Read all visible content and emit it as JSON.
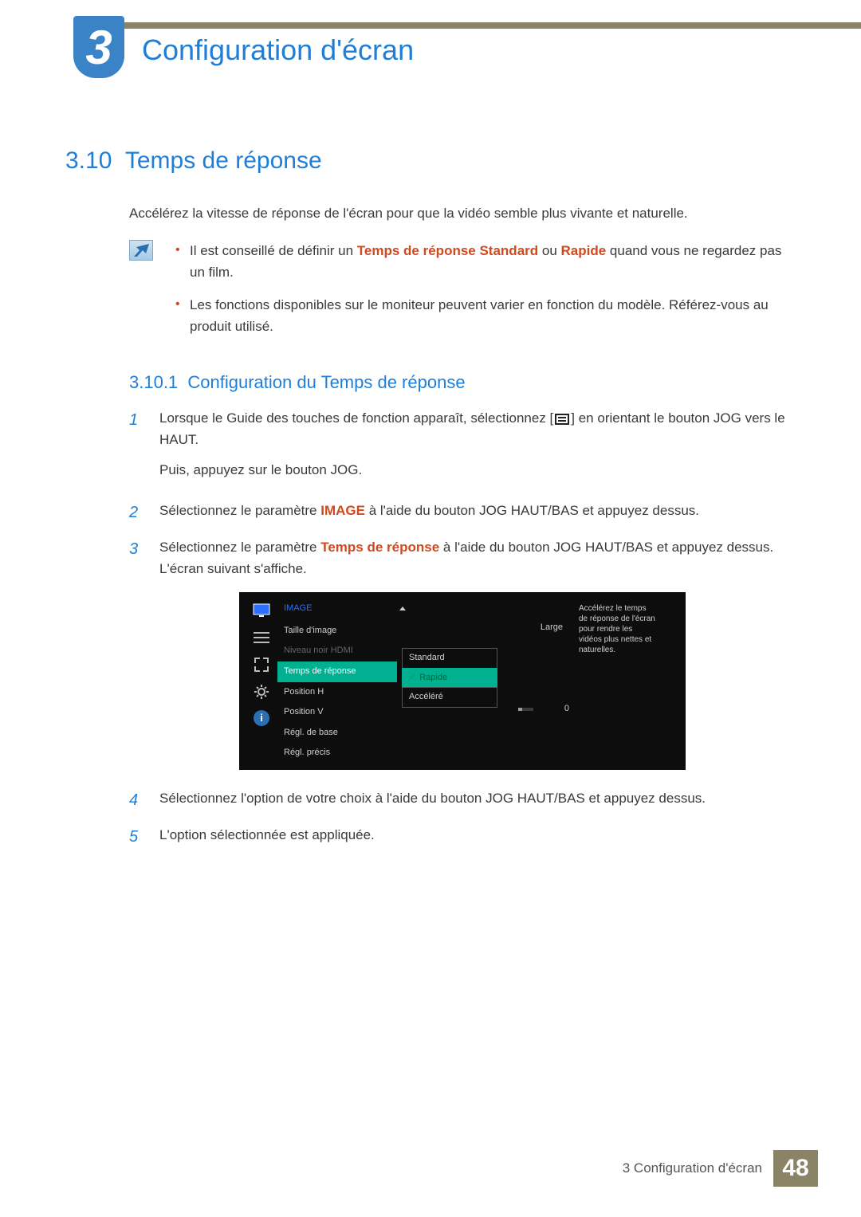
{
  "chapter": {
    "number": "3",
    "title": "Configuration d'écran"
  },
  "section": {
    "number": "3.10",
    "title": "Temps de réponse"
  },
  "intro": "Accélérez la vitesse de réponse de l'écran pour que la vidéo semble plus vivante et naturelle.",
  "notes": {
    "items": [
      {
        "pre": "Il est conseillé de définir un ",
        "hl1": "Temps de réponse Standard",
        "mid": " ou ",
        "hl2": "Rapide",
        "post": " quand vous ne regardez pas un film."
      },
      {
        "text": "Les fonctions disponibles sur le moniteur peuvent varier en fonction du modèle. Référez-vous au produit utilisé."
      }
    ]
  },
  "subsection": {
    "number": "3.10.1",
    "title": "Configuration du Temps de réponse"
  },
  "steps": {
    "s1": {
      "l1a": "Lorsque le Guide des touches de fonction apparaît, sélectionnez [",
      "l1b": "] en orientant le bouton JOG vers le HAUT.",
      "l2": "Puis, appuyez sur le bouton JOG."
    },
    "s2": {
      "pre": "Sélectionnez le paramètre ",
      "hl": "IMAGE",
      "post": " à l'aide du bouton JOG HAUT/BAS et appuyez dessus."
    },
    "s3": {
      "pre": "Sélectionnez le paramètre ",
      "hl": "Temps de réponse",
      "post": " à l'aide du bouton JOG HAUT/BAS et appuyez dessus. L'écran suivant s'affiche."
    },
    "s4": "Sélectionnez l'option de votre choix à l'aide du bouton JOG HAUT/BAS et appuyez dessus.",
    "s5": "L'option sélectionnée est appliquée."
  },
  "osd": {
    "category": "IMAGE",
    "menu": {
      "taille": {
        "label": "Taille d'image",
        "value": "Large"
      },
      "niveau": "Niveau noir HDMI",
      "temps": "Temps de réponse",
      "posh": "Position H",
      "posv": "Position V",
      "base": "Régl. de base",
      "precis": "Régl. précis",
      "precis_val": "0"
    },
    "options": {
      "standard": "Standard",
      "rapide": "Rapide",
      "accelere": "Accéléré"
    },
    "desc": "Accélérez le temps de réponse de l'écran pour rendre les vidéos plus nettes et naturelles."
  },
  "footer": {
    "label": "3 Configuration d'écran",
    "page": "48"
  }
}
